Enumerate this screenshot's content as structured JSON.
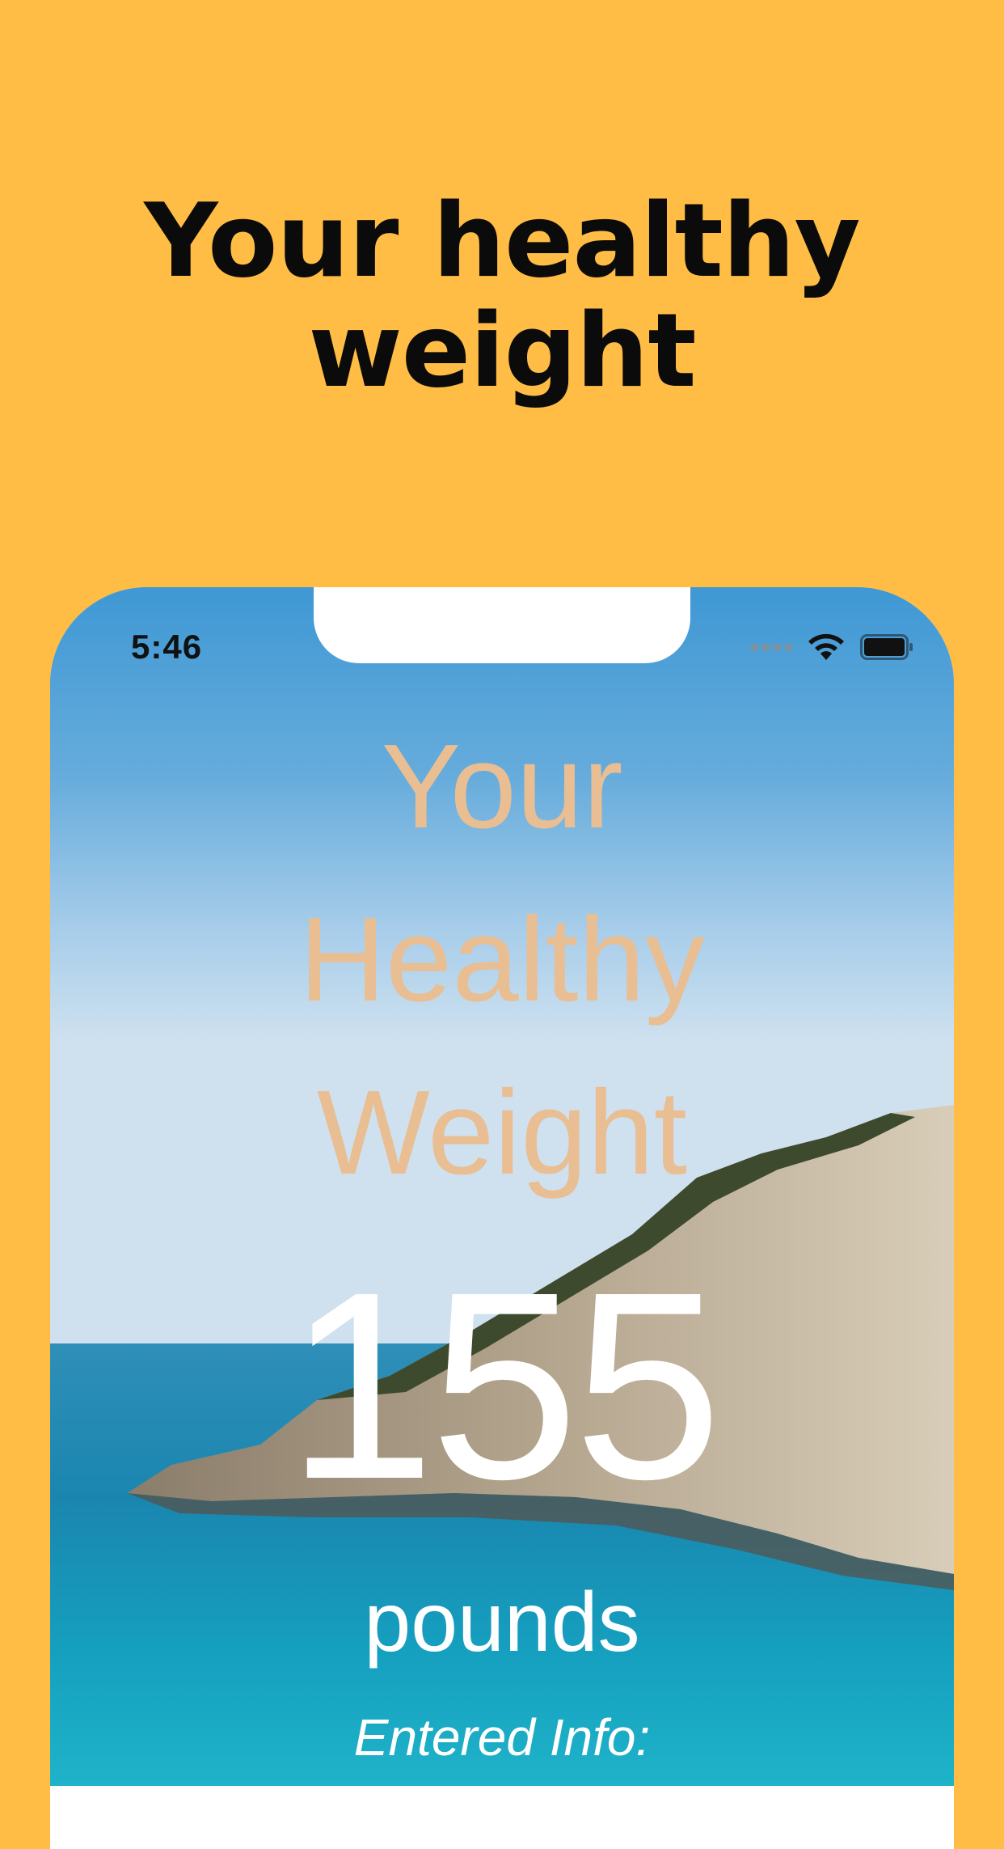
{
  "promo": {
    "headline_line1": "Your healthy",
    "headline_line2": "weight"
  },
  "status_bar": {
    "time": "5:46",
    "wifi_icon": "wifi-icon",
    "battery_icon": "battery-icon"
  },
  "screen": {
    "title_line1": "Your",
    "title_line2": "Healthy",
    "title_line3": "Weight",
    "weight_value": "155",
    "weight_unit": "pounds",
    "entered_info_label": "Entered Info:"
  },
  "colors": {
    "background": "#FFBD45",
    "title_text": "#E8BE92",
    "value_text": "#FFFFFF"
  }
}
